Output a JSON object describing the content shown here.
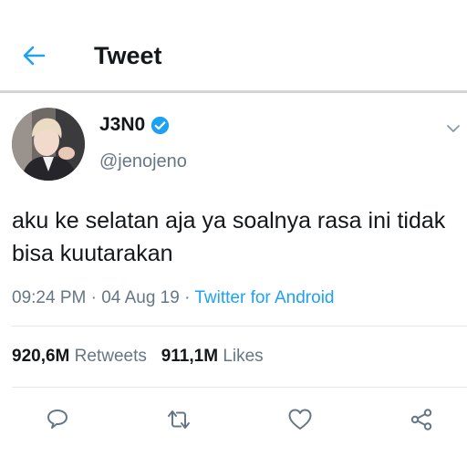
{
  "header": {
    "title": "Tweet",
    "back_icon": "arrow-left-icon",
    "accent_color": "#1da1f2"
  },
  "user": {
    "name": "J3N0",
    "handle": "@jenojeno",
    "verified": true
  },
  "tweet": {
    "text": "aku ke selatan aja ya soalnya rasa ini tidak bisa kuutarakan",
    "time": "09:24 PM",
    "date": "04 Aug 19",
    "source": "Twitter for Android",
    "separator": "·"
  },
  "stats": {
    "retweets_count": "920,6M",
    "retweets_label": "Retweets",
    "likes_count": "911,1M",
    "likes_label": "Likes"
  },
  "actions": [
    "reply-icon",
    "retweet-icon",
    "like-icon",
    "share-icon"
  ],
  "colors": {
    "text": "#14171a",
    "secondary": "#657786",
    "link": "#1da1f2",
    "divider": "#e1e8ed"
  }
}
